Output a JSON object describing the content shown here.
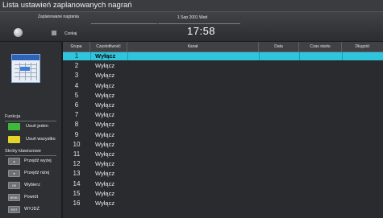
{
  "window": {
    "title": "Lista ustawień zaplanowanych nagrań"
  },
  "header": {
    "caption": "Zaplanowane nagrania",
    "wait_label": "Czekaj",
    "date": "1 Sep 2001 Wed",
    "time": "17:58"
  },
  "sidebar": {
    "function_title": "Funkcja",
    "functions": [
      {
        "color": "#3fb93c",
        "label": "Usuń jeden",
        "icon": "green-key"
      },
      {
        "color": "#e3d42b",
        "label": "Usuń wszystko",
        "icon": "yellow-key"
      }
    ],
    "shortcut_title": "Skróty klawiszowe",
    "shortcuts": [
      {
        "key": "▲",
        "label": "Przejdź wyżej"
      },
      {
        "key": "▼",
        "label": "Przejdź niżej"
      },
      {
        "key": "OK",
        "label": "Wybierz"
      },
      {
        "key": "MENU",
        "label": "Powrót"
      },
      {
        "key": "EXIT",
        "label": "WYJDŹ"
      }
    ]
  },
  "table": {
    "columns": [
      "Grupa",
      "Częstotliwość",
      "Kanał",
      "Data",
      "Czas startu",
      "Długość"
    ],
    "rows": [
      {
        "group": "1",
        "freq": "Wyłącz"
      },
      {
        "group": "2",
        "freq": "Wyłącz"
      },
      {
        "group": "3",
        "freq": "Wyłącz"
      },
      {
        "group": "4",
        "freq": "Wyłącz"
      },
      {
        "group": "5",
        "freq": "Wyłącz"
      },
      {
        "group": "6",
        "freq": "Wyłącz"
      },
      {
        "group": "7",
        "freq": "Wyłącz"
      },
      {
        "group": "8",
        "freq": "Wyłącz"
      },
      {
        "group": "9",
        "freq": "Wyłącz"
      },
      {
        "group": "10",
        "freq": "Wyłącz"
      },
      {
        "group": "11",
        "freq": "Wyłącz"
      },
      {
        "group": "12",
        "freq": "Wyłącz"
      },
      {
        "group": "13",
        "freq": "Wyłącz"
      },
      {
        "group": "14",
        "freq": "Wyłącz"
      },
      {
        "group": "15",
        "freq": "Wyłącz"
      },
      {
        "group": "16",
        "freq": "Wyłącz"
      }
    ],
    "selected_row": 0,
    "highlight_color": "#2fc6dd"
  }
}
